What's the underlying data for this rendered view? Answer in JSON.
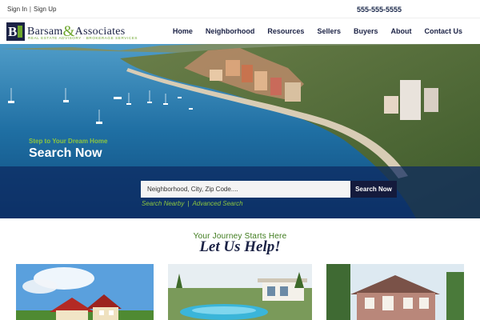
{
  "topbar": {
    "sign_in": "Sign In",
    "separator": "|",
    "sign_up": "Sign Up",
    "phone": "555-555-5555"
  },
  "logo": {
    "mark": "B",
    "name_part1": "Barsam",
    "ampersand": "&",
    "name_part2": "Associates",
    "tagline": "REAL ESTATE ADVISORY · BROKERAGE SERVICES"
  },
  "nav": {
    "items": [
      {
        "label": "Home"
      },
      {
        "label": "Neighborhood"
      },
      {
        "label": "Resources"
      },
      {
        "label": "Sellers"
      },
      {
        "label": "Buyers"
      },
      {
        "label": "About"
      },
      {
        "label": "Contact Us"
      }
    ]
  },
  "hero": {
    "subheading": "Step to Your Dream Home",
    "heading": "Search Now",
    "search_placeholder": "Neighborhood, City, Zip Code....",
    "search_button": "Search Now",
    "link_nearby": "Search Nearby",
    "link_separator": "|",
    "link_advanced": "Advanced Search"
  },
  "intro": {
    "tagline": "Your Journey Starts Here",
    "heading": "Let Us Help!"
  },
  "colors": {
    "navy": "#1b2245",
    "green": "#6da62c",
    "accent_green": "#8cc63f",
    "search_band": "#0c285f"
  },
  "cards": [
    {
      "icon": "red-roof-house-photo"
    },
    {
      "icon": "pool-villa-photo"
    },
    {
      "icon": "brick-colonial-house-photo"
    }
  ]
}
